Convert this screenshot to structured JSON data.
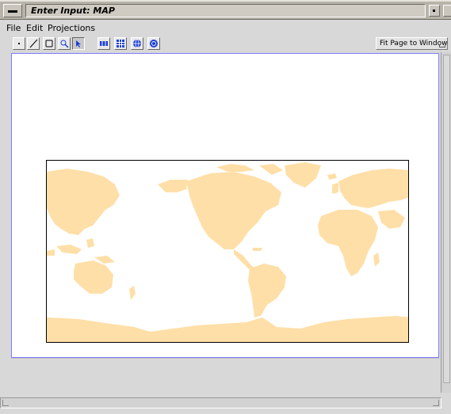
{
  "window": {
    "title": "Enter Input: MAP"
  },
  "menu": {
    "file": "File",
    "edit": "Edit",
    "projections": "Projections"
  },
  "toolbar": {
    "tools": [
      "point-tool-icon",
      "line-tool-icon",
      "rectangle-tool-icon",
      "zoom-pan-tool-icon",
      "select-tool-icon",
      "grid-coarse-icon",
      "grid-fine-icon",
      "globe-icon",
      "globe-rotate-icon"
    ],
    "fit_option": "Fit Page to Window"
  },
  "colors": {
    "land": "#ffdfa8",
    "ocean": "#ffffff",
    "frame": "#7d7dff"
  }
}
